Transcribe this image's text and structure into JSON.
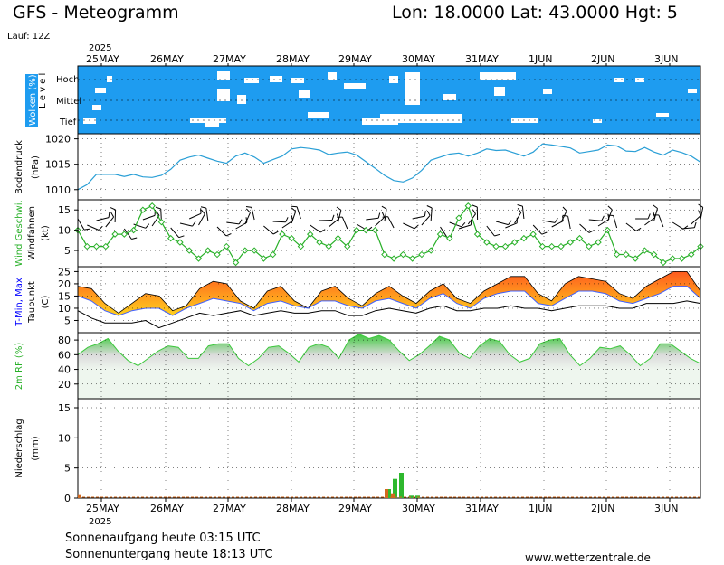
{
  "header": {
    "title": "GFS - Meteogramm",
    "location": "Lon: 18.0000 Lat: 43.0000 Hgt: 5",
    "run": "Lauf: 12Z",
    "year_top": "2025",
    "year_bottom": "2025"
  },
  "footer": {
    "sunrise": "Sonnenaufgang heute 03:15 UTC",
    "sunset": "Sonnenuntergang heute 18:13 UTC",
    "website": "www.wetterzentrale.de"
  },
  "colors": {
    "cloud_bg": "#1e9cf0",
    "cloud_gap": "#ffffff",
    "pressure": "#2a9fd6",
    "wind": "#28b028",
    "wind_marker_fill": "#ffffff",
    "tmax_hot": "#ff5a1e",
    "tmax_warm": "#ffd21e",
    "tmin": "#4060ff",
    "dewpoint": "#000000",
    "rh": "#3cc83c",
    "rh_band": "#dcdcdc",
    "rh_band_low": "#eef6ee",
    "precip_convective": "#2eb82e",
    "precip_large": "#d2691e",
    "grid": "#000000",
    "title_label_blue": "#0000ff",
    "title_label_red": "#ff0000",
    "title_label_green": "#28b028"
  },
  "chart_data": {
    "type": "line",
    "time_axis": {
      "start": "2025-05-24T12:00Z",
      "end": "2025-06-03T12:00Z",
      "day_labels": [
        "25MAY",
        "26MAY",
        "27MAY",
        "28MAY",
        "29MAY",
        "30MAY",
        "31MAY",
        "1JUN",
        "2JUN",
        "3JUN"
      ]
    },
    "panels": [
      {
        "id": "clouds",
        "ylabel": "Wolken (%)",
        "level_label": "L e v e l",
        "levels": [
          "Hoch",
          "Mittel",
          "Tief"
        ]
      },
      {
        "id": "pressure",
        "ylabel": "Bodendruck",
        "unit": "(hPa)",
        "ylim": [
          1008,
          1021
        ],
        "ticks": [
          1010,
          1015,
          1020
        ],
        "values": [
          1010,
          1011,
          1013,
          1013,
          1013,
          1012.6,
          1013,
          1012.5,
          1012.4,
          1012.8,
          1014,
          1015.8,
          1016.4,
          1016.8,
          1016.2,
          1015.6,
          1015.2,
          1016.6,
          1017.2,
          1016.4,
          1015.2,
          1015.9,
          1016.6,
          1018,
          1018.3,
          1018.1,
          1017.8,
          1016.9,
          1017.2,
          1017.4,
          1016.8,
          1015.5,
          1014.2,
          1012.8,
          1011.8,
          1011.5,
          1012.3,
          1013.8,
          1015.8,
          1016.4,
          1017,
          1017.2,
          1016.6,
          1017.2,
          1018,
          1017.7,
          1017.8,
          1017.2,
          1016.6,
          1017.4,
          1019,
          1018.8,
          1018.5,
          1018.2,
          1017.2,
          1017.5,
          1017.8,
          1018.8,
          1018.6,
          1017.6,
          1017.5,
          1018.3,
          1017.4,
          1016.8,
          1017.8,
          1017.3,
          1016.6,
          1015.4
        ]
      },
      {
        "id": "wind",
        "ylabel": "Wind Geschwi.",
        "ylabel2": "Windfahnen",
        "unit": "(kt)",
        "ylim": [
          1,
          17.5
        ],
        "ticks": [
          5,
          10,
          15
        ],
        "values": [
          10,
          6,
          6,
          6,
          9,
          9,
          10,
          15,
          16,
          12,
          8,
          7,
          5,
          3,
          5,
          4,
          6,
          2,
          5,
          5,
          3,
          4,
          9,
          8,
          6,
          9,
          7,
          6,
          8,
          6,
          10,
          10,
          10,
          4,
          3,
          4,
          3,
          4,
          5,
          9,
          8,
          13,
          16,
          9,
          7,
          6,
          6,
          7,
          8,
          9,
          6,
          6,
          6,
          7,
          8,
          6,
          7,
          10,
          4,
          4,
          3,
          5,
          4,
          2,
          3,
          3,
          4,
          6
        ]
      },
      {
        "id": "temperature",
        "ylabel": "T-Min, Max",
        "ylabel2": "Taupunkt",
        "unit": "(C)",
        "ylim": [
          0,
          27
        ],
        "ticks": [
          5,
          10,
          15,
          20,
          25
        ],
        "tmax": [
          19,
          18,
          12,
          8,
          12,
          16,
          15,
          9,
          11,
          18,
          21,
          20,
          13,
          10,
          17,
          19,
          13,
          10,
          17,
          19,
          14,
          11,
          16,
          19,
          15,
          12,
          17,
          20,
          14,
          12,
          17,
          20,
          23,
          23,
          16,
          13,
          20,
          23,
          22,
          21,
          16,
          14,
          19,
          22,
          25,
          25,
          17
        ],
        "tmin": [
          15,
          13,
          9,
          7,
          9,
          10,
          10,
          7,
          10,
          12,
          14,
          13,
          12,
          9,
          12,
          13,
          11,
          10,
          13,
          13,
          11,
          10,
          13,
          14,
          12,
          10,
          14,
          16,
          12,
          10,
          14,
          16,
          17,
          17,
          12,
          11,
          14,
          17,
          17,
          16,
          13,
          12,
          14,
          16,
          19,
          19,
          14
        ],
        "dewpoint": [
          9,
          6,
          4,
          4,
          4,
          5,
          2,
          4,
          6,
          8,
          7,
          8,
          9,
          7,
          8,
          9,
          8,
          8,
          9,
          9,
          7,
          7,
          9,
          10,
          9,
          8,
          10,
          11,
          9,
          9,
          10,
          10,
          11,
          10,
          10,
          9,
          10,
          11,
          11,
          11,
          10,
          10,
          12,
          12,
          12,
          13,
          12
        ]
      },
      {
        "id": "rh",
        "ylabel": "2m RF (%)",
        "ylim": [
          0,
          90
        ],
        "ticks": [
          20,
          40,
          60,
          80
        ],
        "values": [
          60,
          70,
          75,
          82,
          65,
          52,
          45,
          55,
          65,
          72,
          70,
          55,
          55,
          72,
          75,
          75,
          55,
          45,
          55,
          70,
          72,
          62,
          50,
          70,
          75,
          70,
          55,
          80,
          88,
          82,
          86,
          80,
          65,
          52,
          60,
          72,
          85,
          80,
          62,
          55,
          72,
          82,
          78,
          60,
          50,
          55,
          75,
          80,
          82,
          60,
          45,
          55,
          70,
          68,
          72,
          60,
          45,
          55,
          75,
          75,
          65,
          55,
          48
        ]
      },
      {
        "id": "precip",
        "ylabel": "Niederschlag",
        "unit": "(mm)",
        "ylim": [
          0,
          16.5
        ],
        "ticks": [
          0,
          5,
          10,
          15
        ],
        "large_scale": [
          0.8,
          0,
          0,
          0,
          0,
          0,
          0,
          0,
          0,
          0,
          0,
          0,
          0,
          0,
          0,
          0,
          0,
          0,
          0,
          0,
          0,
          0,
          0,
          0,
          0,
          0,
          0,
          0,
          0,
          0,
          0,
          0,
          0,
          0,
          0,
          0,
          0,
          0,
          0,
          0,
          0,
          0,
          0,
          0,
          0,
          0,
          0,
          0,
          0,
          0,
          0,
          0,
          0,
          0,
          0,
          0,
          0,
          0,
          0,
          0,
          0,
          0,
          0,
          0,
          0,
          0,
          0,
          0,
          0,
          0,
          0,
          0,
          0,
          0,
          0,
          0,
          0,
          0,
          0,
          0,
          0
        ],
        "convective_highlight": {
          "times": [
            "29MAY 18Z",
            "29MAY 21Z",
            "30MAY 00Z",
            "30MAY 03Z",
            "30MAY 06Z"
          ],
          "values": [
            1.5,
            3.2,
            4.2,
            0.4,
            0.4
          ],
          "large_values": [
            1.5,
            0.8,
            0,
            0,
            0
          ]
        }
      }
    ]
  }
}
